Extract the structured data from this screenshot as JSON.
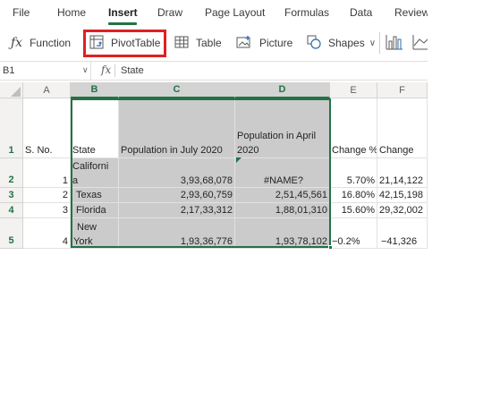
{
  "menu": {
    "tabs": [
      {
        "label": "File"
      },
      {
        "label": "Home"
      },
      {
        "label": "Insert",
        "active": true
      },
      {
        "label": "Draw"
      },
      {
        "label": "Page Layout"
      },
      {
        "label": "Formulas"
      },
      {
        "label": "Data"
      },
      {
        "label": "Review"
      }
    ]
  },
  "ribbon": {
    "function_label": "Function",
    "pivottable_label": "PivotTable",
    "table_label": "Table",
    "picture_label": "Picture",
    "shapes_label": "Shapes",
    "icons": [
      "fx-icon",
      "pivottable-icon",
      "table-icon",
      "picture-icon",
      "shapes-icon",
      "column-chart-icon",
      "line-chart-icon"
    ],
    "highlight_color": "#e02020"
  },
  "formula_bar": {
    "namebox": "B1",
    "fx": "fx",
    "value": "State"
  },
  "grid": {
    "columns": [
      "A",
      "B",
      "C",
      "D",
      "E",
      "F"
    ],
    "rows": [
      "1",
      "2",
      "3",
      "4",
      "5"
    ],
    "header_row": {
      "A": "S. No.",
      "B": "State",
      "C": "Population in July 2020",
      "D1": "Population in April",
      "D2": "2020",
      "E": "Change %",
      "F": "Change"
    },
    "data": [
      {
        "A": "1",
        "B1": "Californi",
        "B2": "a",
        "C": "3,93,68,078",
        "D": "#NAME?",
        "E": "5.70%",
        "F": "21,14,122"
      },
      {
        "A": "2",
        "B": "Texas",
        "C": "2,93,60,759",
        "D": "2,51,45,561",
        "E": "16.80%",
        "F": "42,15,198"
      },
      {
        "A": "3",
        "B": "Florida",
        "C": "2,17,33,312",
        "D": "1,88,01,310",
        "E": "15.60%",
        "F": "29,32,002"
      },
      {
        "A": "4",
        "B1": "New",
        "B2": "York",
        "C": "1,93,36,776",
        "D": "1,93,78,102",
        "E": "−0.2%",
        "F": "−41,326"
      }
    ]
  },
  "colors": {
    "accent": "#217346",
    "selection": "#cbcbcb"
  }
}
